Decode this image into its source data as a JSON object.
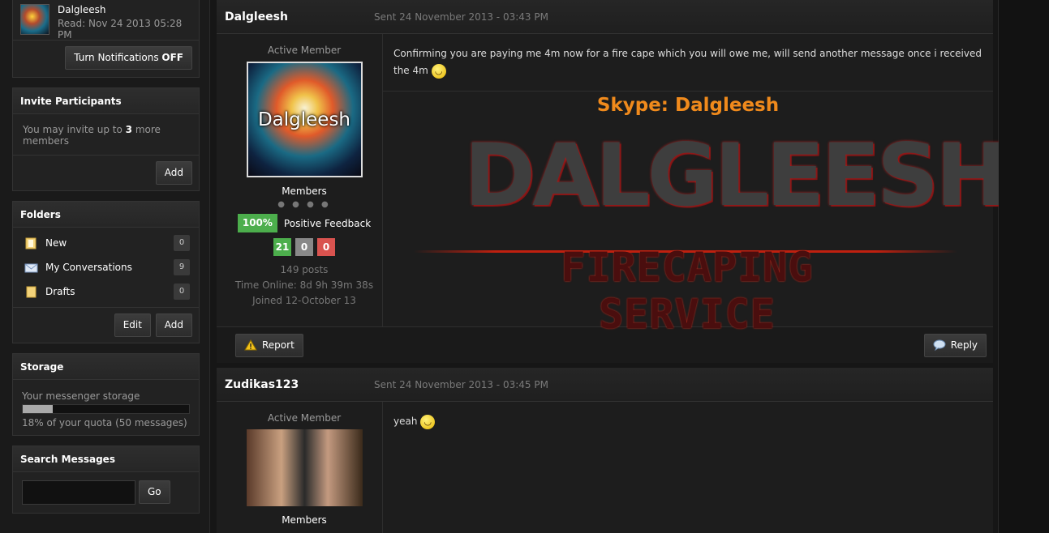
{
  "top_user": {
    "name": "Dalgleesh",
    "read": "Read: Nov 24 2013 05:28 PM",
    "notifications_label": "Turn Notifications ",
    "notifications_state": "OFF"
  },
  "invite": {
    "title": "Invite Participants",
    "text_pre": "You may invite up to ",
    "text_count": "3",
    "text_post": " more members",
    "add_label": "Add"
  },
  "folders": {
    "title": "Folders",
    "items": [
      {
        "label": "New",
        "count": "0",
        "icon": "new-folder-icon"
      },
      {
        "label": "My Conversations",
        "count": "9",
        "icon": "envelope-icon"
      },
      {
        "label": "Drafts",
        "count": "0",
        "icon": "drafts-folder-icon"
      }
    ],
    "edit_label": "Edit",
    "add_label": "Add"
  },
  "storage": {
    "title": "Storage",
    "label": "Your messenger storage",
    "percent": 18,
    "quota_text": "18% of your quota (50 messages)"
  },
  "search": {
    "title": "Search Messages",
    "go_label": "Go"
  },
  "messages": [
    {
      "author": "Dalgleesh",
      "date": "Sent 24 November 2013 - 03:43 PM",
      "rank": "Active Member",
      "avatar_text": "Dalgleesh",
      "group": "Members",
      "feedback_pct": "100%",
      "feedback_label": "Positive Feedback",
      "positive": "21",
      "neutral": "0",
      "negative": "0",
      "posts": "149 posts",
      "time_online": "Time Online: 8d 9h 39m 38s",
      "joined": "Joined 12-October 13",
      "text": "Confirming you are paying me 4m now for a fire cape which you will owe me, will send another message once i received the 4m",
      "sig_skype": "Skype: Dalgleesh",
      "sig_banner": "DALGLEESH",
      "sig_sub": "FIRECAPING SERVICE",
      "report_label": "Report",
      "reply_label": "Reply"
    },
    {
      "author": "Zudikas123",
      "date": "Sent 24 November 2013 - 03:45 PM",
      "rank": "Active Member",
      "group": "Members",
      "text": "yeah"
    }
  ],
  "colors": {
    "positive": "#4cae4c",
    "neutral": "#888888",
    "negative": "#d9534f",
    "skype": "#f08a1c"
  }
}
